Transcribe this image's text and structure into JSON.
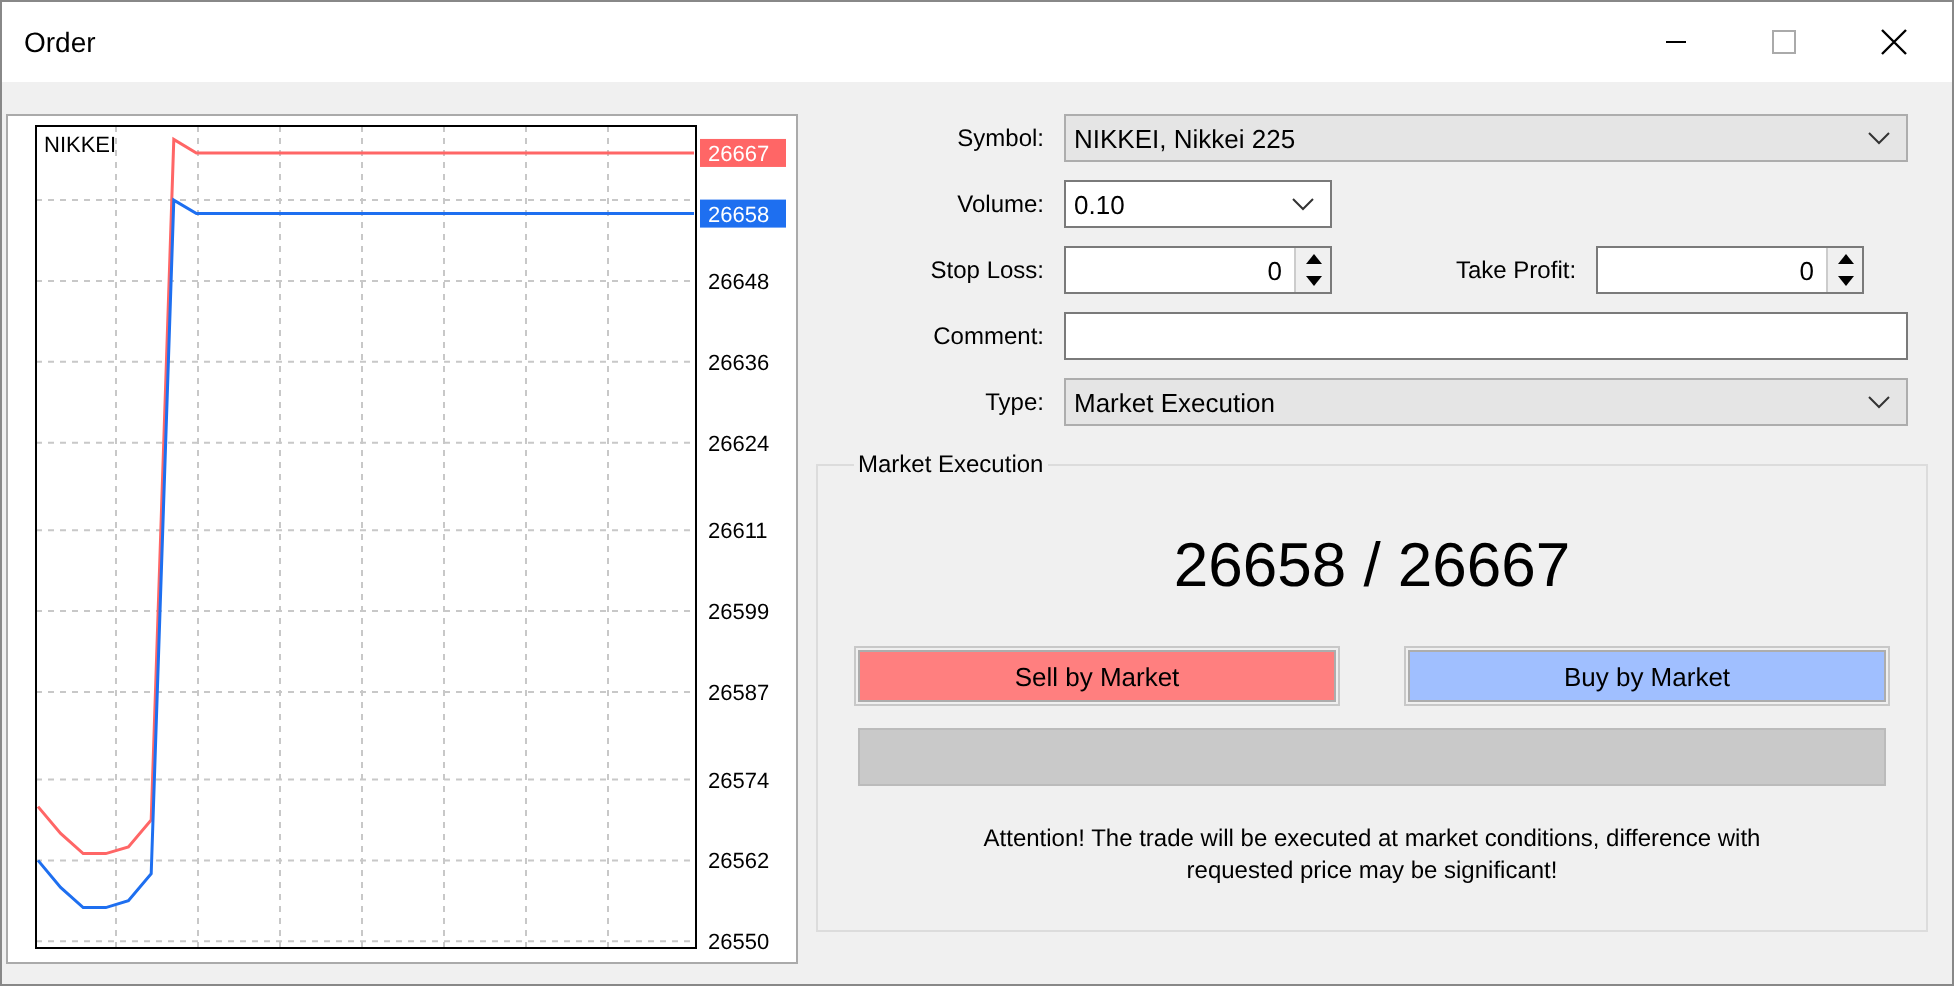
{
  "window": {
    "title": "Order"
  },
  "chart": {
    "symbol": "NIKKEI",
    "price_tags": [
      {
        "text": "26667",
        "color": "#ff6666"
      },
      {
        "text": "26658",
        "color": "#1e6ff0"
      }
    ],
    "chart_data": {
      "type": "line",
      "grid": true,
      "ylim": [
        26549,
        26671
      ],
      "yticks": [
        26648,
        26636,
        26624,
        26611,
        26599,
        26587,
        26574,
        26562,
        26550
      ],
      "series": [
        {
          "color": "#ff6666",
          "values": [
            26570,
            26566,
            26563,
            26563,
            26564,
            26568,
            26669,
            26667,
            26667,
            26667,
            26667,
            26667,
            26667,
            26667,
            26667,
            26667,
            26667,
            26667,
            26667,
            26667,
            26667,
            26667,
            26667,
            26667,
            26667,
            26667,
            26667,
            26667,
            26667,
            26667
          ]
        },
        {
          "color": "#1e6ff0",
          "values": [
            26562,
            26558,
            26555,
            26555,
            26556,
            26560,
            26660,
            26658,
            26658,
            26658,
            26658,
            26658,
            26658,
            26658,
            26658,
            26658,
            26658,
            26658,
            26658,
            26658,
            26658,
            26658,
            26658,
            26658,
            26658,
            26658,
            26658,
            26658,
            26658,
            26658
          ]
        }
      ]
    }
  },
  "form": {
    "symbol": {
      "label": "Symbol:",
      "value": "NIKKEI, Nikkei 225"
    },
    "volume": {
      "label": "Volume:",
      "value": "0.10"
    },
    "stop_loss": {
      "label": "Stop Loss:",
      "value": "0"
    },
    "take_profit": {
      "label": "Take Profit:",
      "value": "0"
    },
    "comment": {
      "label": "Comment:"
    },
    "type": {
      "label": "Type:",
      "value": "Market Execution"
    }
  },
  "execution": {
    "title": "Market Execution",
    "quote": "26658 / 26667",
    "sell_button": "Sell by Market",
    "buy_button": "Buy by Market",
    "notice": "Attention! The trade will be executed at market conditions, difference with requested price may be significant!"
  }
}
